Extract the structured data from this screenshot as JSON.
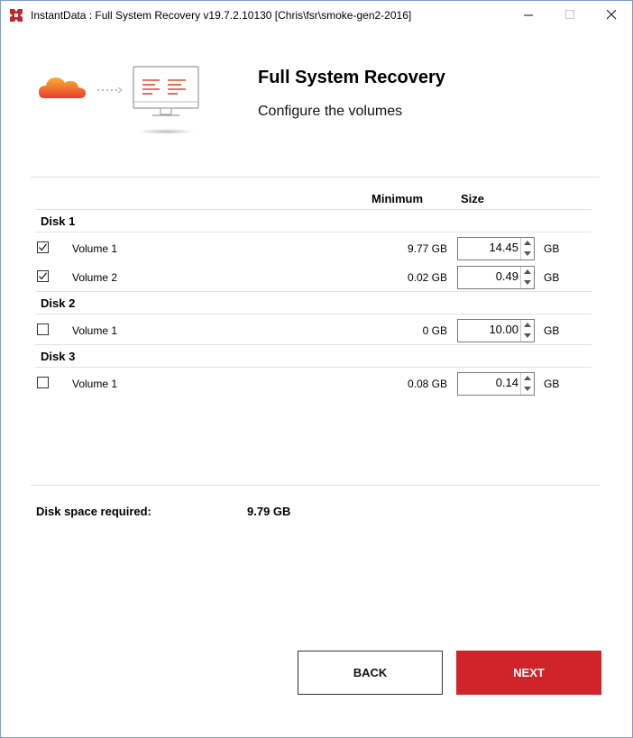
{
  "window": {
    "title": "InstantData : Full System Recovery v19.7.2.10130 [Chris\\fsr\\smoke-gen2-2016]",
    "icons": {
      "app": "app-logo-icon",
      "minimize": "minimize-icon",
      "maximize": "maximize-icon",
      "close": "close-icon"
    }
  },
  "header": {
    "title": "Full System Recovery",
    "subtitle": "Configure the volumes",
    "illustration_icons": [
      "cloud-icon",
      "monitor-icon"
    ]
  },
  "table": {
    "columns": {
      "minimum": "Minimum",
      "size": "Size"
    },
    "disks": [
      {
        "label": "Disk 1",
        "volumes": [
          {
            "label": "Volume 1",
            "checked": true,
            "minimum": "9.77 GB",
            "size": "14.45",
            "unit": "GB"
          },
          {
            "label": "Volume 2",
            "checked": true,
            "minimum": "0.02 GB",
            "size": "0.49",
            "unit": "GB"
          }
        ]
      },
      {
        "label": "Disk 2",
        "volumes": [
          {
            "label": "Volume 1",
            "checked": false,
            "minimum": "0 GB",
            "size": "10.00",
            "unit": "GB"
          }
        ]
      },
      {
        "label": "Disk 3",
        "volumes": [
          {
            "label": "Volume 1",
            "checked": false,
            "minimum": "0.08 GB",
            "size": "0.14",
            "unit": "GB"
          }
        ]
      }
    ]
  },
  "summary": {
    "label": "Disk space required:",
    "value": "9.79 GB"
  },
  "buttons": {
    "back": "BACK",
    "next": "NEXT"
  },
  "colors": {
    "accent": "#d1232a",
    "cloud_top": "#f5a623",
    "cloud_bottom": "#e8452a"
  }
}
